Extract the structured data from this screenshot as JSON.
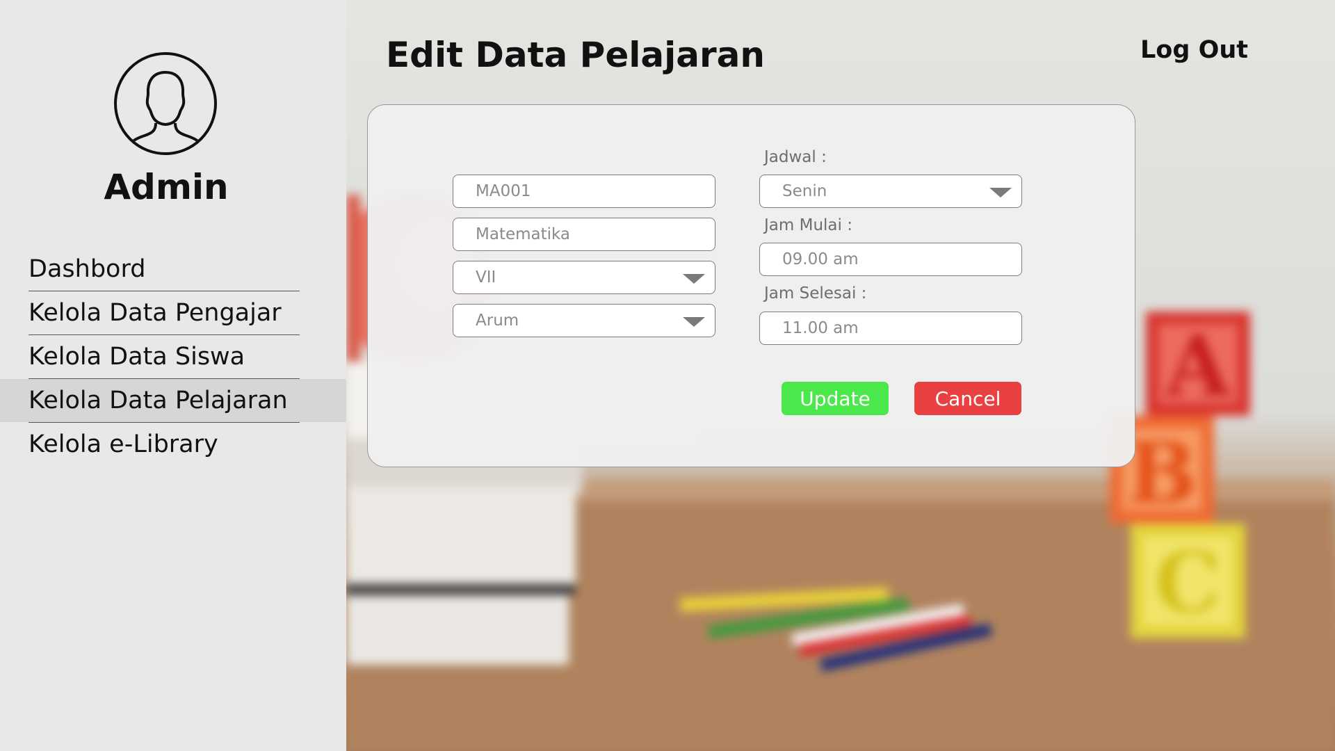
{
  "sidebar": {
    "user_name": "Admin",
    "menu": [
      {
        "label": "Dashbord",
        "active": false
      },
      {
        "label": "Kelola Data Pengajar",
        "active": false
      },
      {
        "label": "Kelola Data Siswa",
        "active": false
      },
      {
        "label": "Kelola Data Pelajaran",
        "active": true
      },
      {
        "label": "Kelola e-Library",
        "active": false
      }
    ]
  },
  "header": {
    "title": "Edit Data Pelajaran",
    "logout_label": "Log Out"
  },
  "form": {
    "kode": "MA001",
    "nama": "Matematika",
    "kelas": "VII",
    "pengajar": "Arum",
    "jadwal_label": "Jadwal :",
    "jadwal": "Senin",
    "jam_mulai_label": "Jam Mulai :",
    "jam_mulai": "09.00 am",
    "jam_selesai_label": "Jam Selesai :",
    "jam_selesai": "11.00 am",
    "update_label": "Update",
    "cancel_label": "Cancel"
  },
  "colors": {
    "update": "#4ae84a",
    "cancel": "#e94141",
    "sidebar_bg": "#e8e8e8",
    "active_item_bg": "#d6d6d6"
  }
}
